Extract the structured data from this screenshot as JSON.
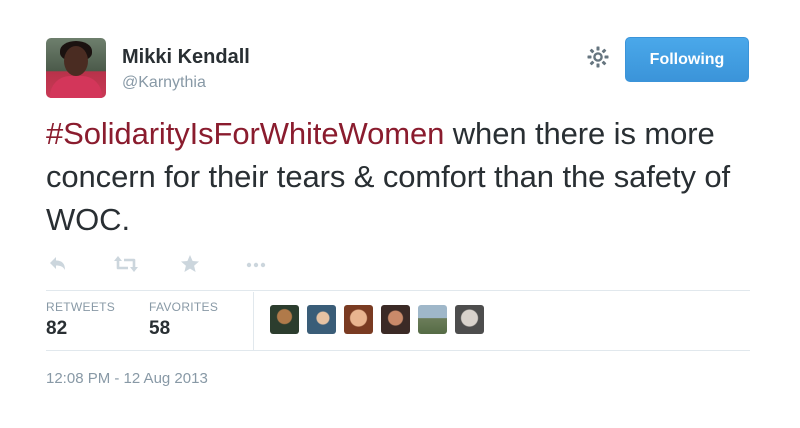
{
  "author": {
    "name": "Mikki Kendall",
    "handle": "@Karnythia"
  },
  "header": {
    "follow_label": "Following",
    "settings_icon": "gear-icon"
  },
  "tweet": {
    "hashtag": "#SolidarityIsForWhiteWomen",
    "text_rest": " when there is more concern for their tears & comfort than the safety of WOC."
  },
  "actions": [
    "reply-icon",
    "retweet-icon",
    "favorite-icon",
    "more-icon"
  ],
  "stats": {
    "retweets_label": "RETWEETS",
    "retweets_value": "82",
    "favorites_label": "FAVORITES",
    "favorites_value": "58"
  },
  "favoriters_count_shown": 6,
  "timestamp": "12:08 PM - 12 Aug 2013",
  "colors": {
    "hashtag": "#8a1c2e",
    "follow_button": "#3b94d9",
    "muted_text": "#8899a6",
    "icon_gray": "#ccd6dd"
  }
}
